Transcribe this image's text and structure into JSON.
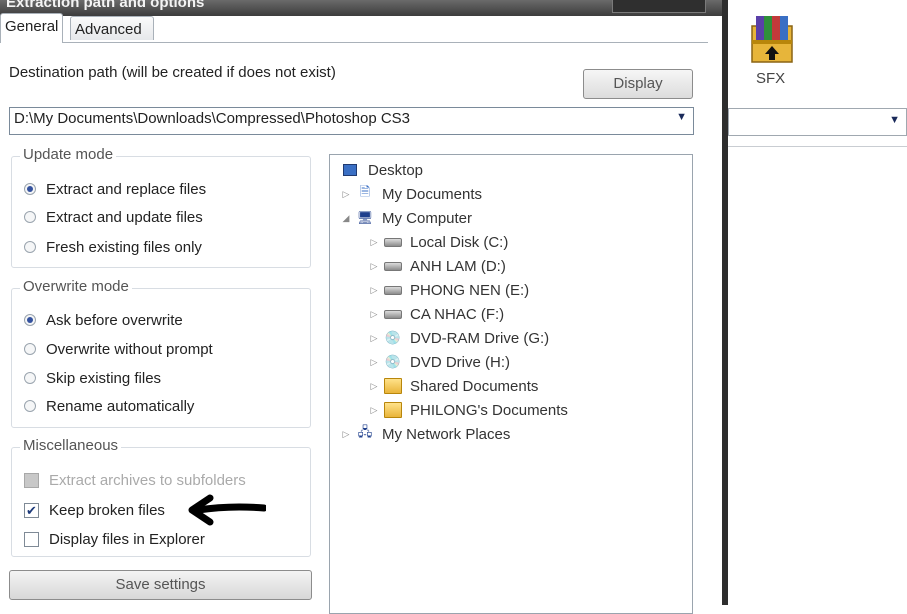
{
  "window": {
    "title": "Extraction path and options"
  },
  "tabs": [
    {
      "label": "General"
    },
    {
      "label": "Advanced"
    }
  ],
  "destination": {
    "label": "Destination path (will be created if does not exist)",
    "display_button": "Display",
    "path_value": "D:\\My Documents\\Downloads\\Compressed\\Photoshop CS3"
  },
  "update_mode": {
    "legend": "Update mode",
    "options": [
      "Extract and replace files",
      "Extract and update files",
      "Fresh existing files only"
    ],
    "selected": 0
  },
  "overwrite_mode": {
    "legend": "Overwrite mode",
    "options": [
      "Ask before overwrite",
      "Overwrite without prompt",
      "Skip existing files",
      "Rename automatically"
    ],
    "selected": 0
  },
  "misc": {
    "legend": "Miscellaneous",
    "options": [
      {
        "label": "Extract archives to subfolders",
        "checked": false,
        "disabled": true
      },
      {
        "label": "Keep broken files",
        "checked": true,
        "disabled": false
      },
      {
        "label": "Display files in Explorer",
        "checked": false,
        "disabled": false
      }
    ]
  },
  "save_button": "Save settings",
  "tree": [
    {
      "label": "Desktop",
      "icon": "desktop-icon",
      "expander": ""
    },
    {
      "label": "My Documents",
      "icon": "my-documents-icon",
      "expander": "▷"
    },
    {
      "label": "My Computer",
      "icon": "computer-icon",
      "expander": "◢"
    },
    {
      "label": "Local Disk (C:)",
      "icon": "disk-icon",
      "expander": "▷"
    },
    {
      "label": "ANH LAM (D:)",
      "icon": "disk-icon",
      "expander": "▷"
    },
    {
      "label": "PHONG NEN (E:)",
      "icon": "disk-icon",
      "expander": "▷"
    },
    {
      "label": "CA NHAC (F:)",
      "icon": "disk-icon",
      "expander": "▷"
    },
    {
      "label": "DVD-RAM Drive (G:)",
      "icon": "dvd-icon",
      "expander": "▷"
    },
    {
      "label": "DVD Drive (H:)",
      "icon": "dvd-icon",
      "expander": "▷"
    },
    {
      "label": "Shared Documents",
      "icon": "folder-icon",
      "expander": "▷"
    },
    {
      "label": "PHILONG's Documents",
      "icon": "folder-icon",
      "expander": "▷"
    },
    {
      "label": "My Network Places",
      "icon": "network-icon",
      "expander": "▷"
    }
  ],
  "background_window": {
    "sfx_label": "SFX"
  }
}
